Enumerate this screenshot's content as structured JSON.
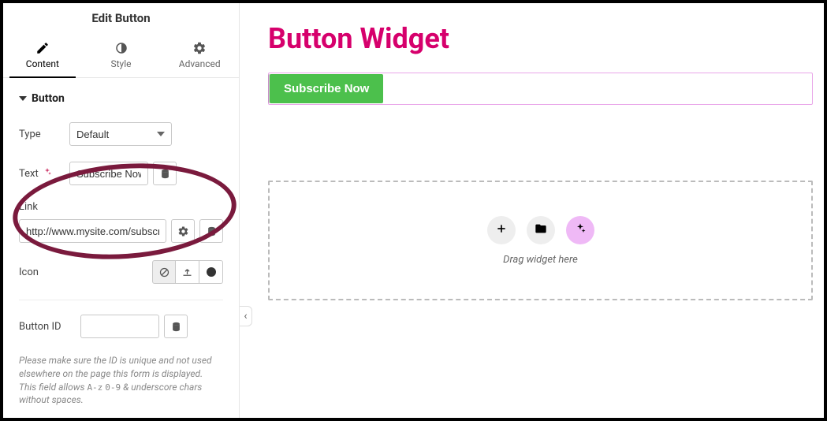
{
  "sidebar": {
    "title": "Edit Button",
    "tabs": {
      "content": "Content",
      "style": "Style",
      "advanced": "Advanced"
    },
    "section_title": "Button",
    "fields": {
      "type_label": "Type",
      "type_value": "Default",
      "text_label": "Text",
      "text_value": "Subscribe Now",
      "link_label": "Link",
      "link_value": "http://www.mysite.com/subscribe",
      "icon_label": "Icon",
      "button_id_label": "Button ID",
      "button_id_value": ""
    },
    "help_text_pre": "Please make sure the ID is unique and not used elsewhere on the page this form is displayed. This field allows ",
    "help_code1": "A-z",
    "help_code2": "0-9",
    "help_text_post": " & underscore chars without spaces."
  },
  "canvas": {
    "title": "Button Widget",
    "button_label": "Subscribe Now",
    "drop_text": "Drag widget here"
  }
}
